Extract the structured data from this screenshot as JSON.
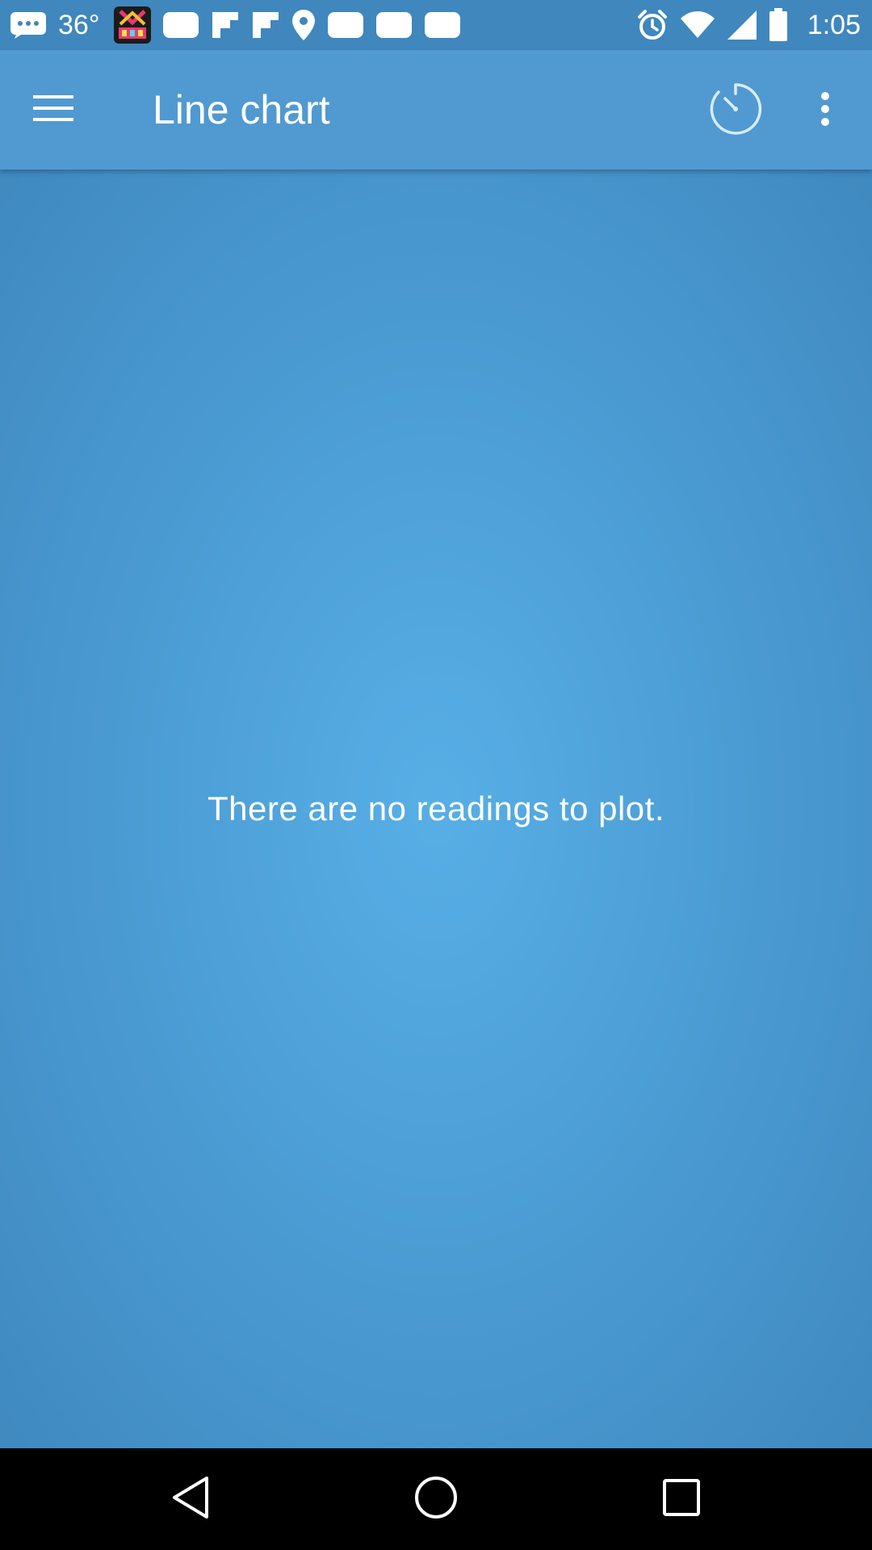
{
  "status_bar": {
    "temperature": "36°",
    "time": "1:05",
    "icons": [
      "message-icon",
      "kpop-app-icon",
      "notification-icon",
      "flipboard-icon",
      "flipboard-icon",
      "location-icon",
      "notification-icon",
      "notification-icon",
      "notification-icon",
      "alarm-icon",
      "wifi-icon",
      "signal-icon",
      "battery-icon"
    ]
  },
  "app_bar": {
    "title": "Line chart",
    "menu_icon": "hamburger-menu-icon",
    "timer_icon": "timer-icon",
    "more_icon": "more-vertical-icon"
  },
  "content": {
    "empty_message": "There are no readings to plot."
  },
  "nav_bar": {
    "back_icon": "back-triangle-icon",
    "home_icon": "home-circle-icon",
    "recents_icon": "recents-square-icon"
  },
  "colors": {
    "status_bar": "#3f87bd",
    "app_bar": "#5199d1",
    "content_center": "#57afe6",
    "content_edge": "#3e88be"
  }
}
